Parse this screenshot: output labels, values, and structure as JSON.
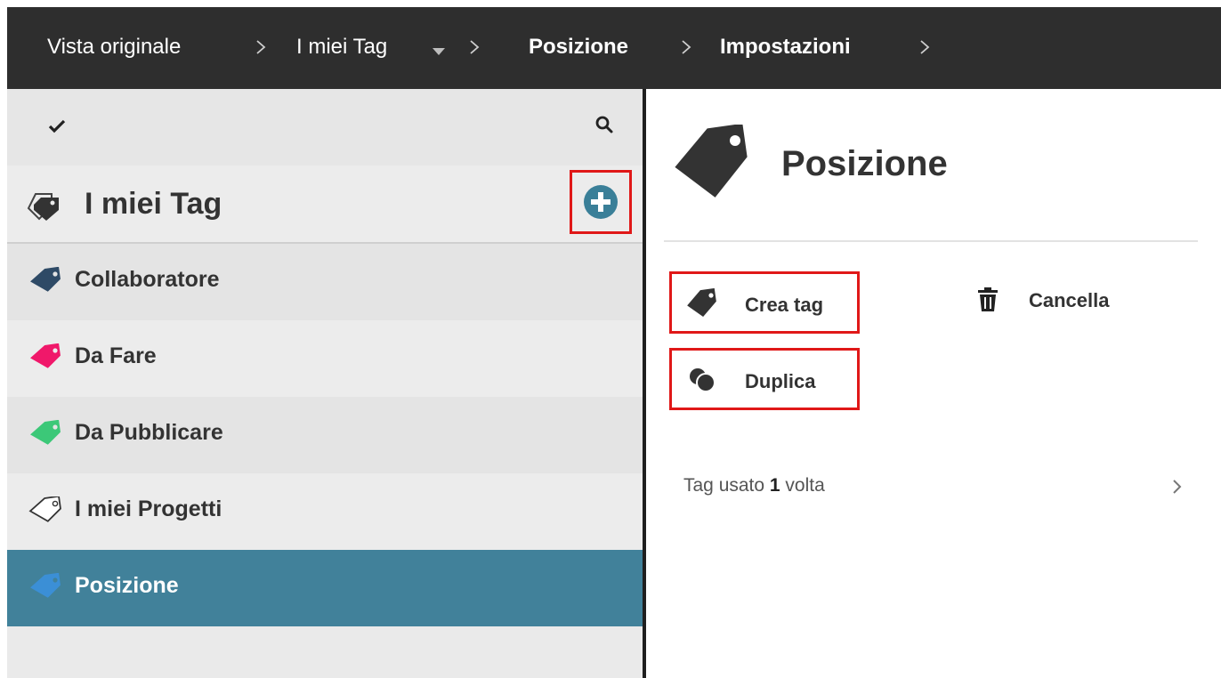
{
  "breadcrumb": {
    "items": [
      "Vista originale",
      "I miei Tag",
      "Posizione",
      "Impostazioni"
    ]
  },
  "sidebar": {
    "header_title": "I miei Tag",
    "items": [
      {
        "label": "Collaboratore",
        "color": "#2e4a66"
      },
      {
        "label": "Da Fare",
        "color": "#f0186a"
      },
      {
        "label": "Da Pubblicare",
        "color": "#3cc878"
      },
      {
        "label": "I miei Progetti",
        "color": "outline"
      },
      {
        "label": "Posizione",
        "color": "#3b8fd6",
        "selected": true
      }
    ]
  },
  "detail": {
    "title": "Posizione",
    "actions": {
      "create": "Crea tag",
      "delete": "Cancella",
      "duplicate": "Duplica"
    },
    "usage_prefix": "Tag usato ",
    "usage_count": "1",
    "usage_suffix": " volta"
  },
  "colors": {
    "topbar": "#2e2e2e",
    "selected_row": "#41819a",
    "add_button": "#3a7f98",
    "highlight_box": "#e01818"
  },
  "icons": [
    "check-icon",
    "search-icon",
    "tags-icon",
    "plus-circle-icon",
    "tag-icon",
    "trash-icon",
    "duplicate-icon",
    "chevron-right-icon"
  ]
}
